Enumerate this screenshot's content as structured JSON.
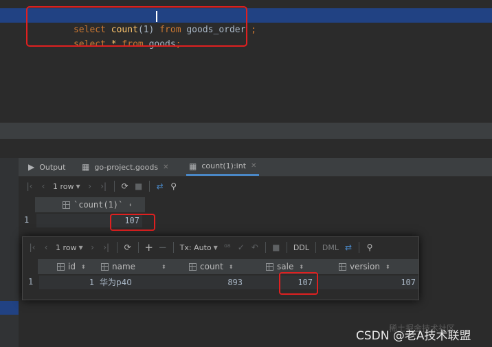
{
  "editor": {
    "line1": {
      "kw1": "select",
      "fn": "count",
      "arg": "(1)",
      "kw2": "from",
      "table": "goods_order",
      "end": ";"
    },
    "line2": {
      "kw1": "select",
      "star": "*",
      "kw2": "from",
      "table": "goods",
      "end": ";"
    }
  },
  "tabs": [
    {
      "label": "Output",
      "icon": "console-icon"
    },
    {
      "label": "go-project.goods",
      "icon": "table-icon"
    },
    {
      "label": "count(1):int",
      "icon": "table-icon"
    }
  ],
  "result1": {
    "rows_label": "1 row",
    "column": "`count(1)`",
    "row_no": "1",
    "value": "107"
  },
  "result2": {
    "rows_label": "1 row",
    "tx_label": "Tx: Auto",
    "ddl_label": "DDL",
    "dml_label": "DML",
    "columns": [
      "id",
      "name",
      "count",
      "sale",
      "version"
    ],
    "row": {
      "row_no": "1",
      "id": "1",
      "name": "华为p40",
      "count": "893",
      "sale": "107",
      "version": "107"
    }
  },
  "watermark": {
    "main": "CSDN @老A技术联盟",
    "faint": "稀土掘金技术社区"
  },
  "colors": {
    "keyword": "#cc7832",
    "function": "#ffc66d",
    "highlight": "#e02020",
    "selection": "#214283"
  }
}
